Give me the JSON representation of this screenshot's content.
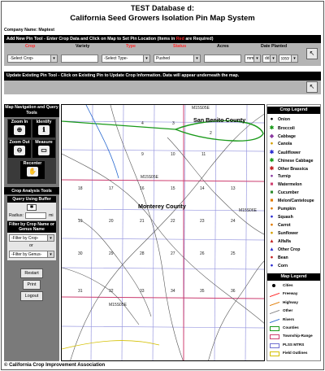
{
  "header": {
    "line1": "TEST Database d:",
    "line2": "California Seed Growers Isolation Pin Map System"
  },
  "company": "Company Name: Maptest",
  "new_pin": {
    "title_part1": "Add New Pin Tool - Enter Crop Data and Click on Map to Set Pin Location (Items in ",
    "title_red": "Red",
    "title_part2": " are Required)",
    "columns": {
      "crop": "Crop",
      "variety": "Variety",
      "type": "Type",
      "status": "Status",
      "acres": "Acres",
      "date_planted": "Date Planted"
    },
    "crop_select": "-Select Crop-",
    "type_select": "-Select Type-",
    "status_select": "Pushed",
    "date_mm": "mm",
    "date_dd": "dd",
    "date_yyyy": "yyyy",
    "go_icon": "pointer-arrow"
  },
  "update_pin": {
    "title": "Update Existing Pin Tool - Click on Existing Pin to Update Crop Information. Data will appear underneath the map.",
    "go_icon": "pointer-arrow"
  },
  "nav": {
    "title": "Map Navigation and Query Tools",
    "zoom_in": "Zoom In",
    "identify": "Identify",
    "zoom_out": "Zoom Out",
    "measure": "Measure",
    "recenter": "Recenter"
  },
  "analysis": {
    "title": "Crop Analysis Tools",
    "buffer_title": "Query Using Buffer",
    "radius_label": "Radius:",
    "radius_unit": "mi",
    "filter_title": "Filter by Crop Name or Genus Name",
    "filter_crop": "-Filter by Crop-",
    "or_label": "or",
    "filter_genus": "-Filter by Genus-"
  },
  "buttons": {
    "restart": "Restart",
    "print": "Print",
    "logout": "Logout"
  },
  "map": {
    "labels": {
      "san_benito": "San Benito County",
      "monterey": "Monterey County",
      "m15s05e_top": "M15S05E",
      "m15s05e_mid": "M15S05E",
      "m15s06e": "M15S06E",
      "m15s05e_bot": "M15S05E"
    },
    "section_numbers": [
      "4",
      "3",
      "2",
      "9",
      "10",
      "11",
      "17",
      "16",
      "15",
      "14",
      "13",
      "18",
      "20",
      "21",
      "22",
      "23",
      "24",
      "19",
      "29",
      "28",
      "27",
      "26",
      "25",
      "30",
      "32",
      "33",
      "34",
      "35",
      "36",
      "31"
    ]
  },
  "crop_legend": {
    "title": "Crop Legend",
    "items": [
      {
        "name": "Onion",
        "symbol": "●",
        "color": "#000000"
      },
      {
        "name": "Broccoli",
        "symbol": "✱",
        "color": "#1a9a1a"
      },
      {
        "name": "Cabbage",
        "symbol": "◆",
        "color": "#8a3aa0"
      },
      {
        "name": "Canola",
        "symbol": "●",
        "color": "#d4a000"
      },
      {
        "name": "Cauliflower",
        "symbol": "✱",
        "color": "#2a2ad0"
      },
      {
        "name": "Chinese Cabbage",
        "symbol": "✱",
        "color": "#1a9a1a"
      },
      {
        "name": "Other Brassica",
        "symbol": "✱",
        "color": "#c02020"
      },
      {
        "name": "Turnip",
        "symbol": "●",
        "color": "#8a3aa0"
      },
      {
        "name": "Watermelon",
        "symbol": "■",
        "color": "#d04070"
      },
      {
        "name": "Cucumber",
        "symbol": "■",
        "color": "#2a8a2a"
      },
      {
        "name": "Melon/Canteloupe",
        "symbol": "■",
        "color": "#e07a00"
      },
      {
        "name": "Pumpkin",
        "symbol": "●",
        "color": "#e07a00"
      },
      {
        "name": "Squash",
        "symbol": "●",
        "color": "#2a2ad0"
      },
      {
        "name": "Carrot",
        "symbol": "●",
        "color": "#e07a00"
      },
      {
        "name": "Sunflower",
        "symbol": "●",
        "color": "#d4a000"
      },
      {
        "name": "Alfalfa",
        "symbol": "▲",
        "color": "#c02020"
      },
      {
        "name": "Other Crop",
        "symbol": "▲",
        "color": "#2a2ad0"
      },
      {
        "name": "Bean",
        "symbol": "●",
        "color": "#c02020"
      },
      {
        "name": "Corn",
        "symbol": "●",
        "color": "#2a2ad0"
      }
    ]
  },
  "map_legend": {
    "title": "Map Legend",
    "items": [
      {
        "name": "Cities",
        "kind": "dot",
        "color": "#000000"
      },
      {
        "name": "Freeway",
        "kind": "line",
        "color": "#ff2020"
      },
      {
        "name": "Highway",
        "kind": "line",
        "color": "#e07a00"
      },
      {
        "name": "Other",
        "kind": "line",
        "color": "#888888"
      },
      {
        "name": "Rivers",
        "kind": "line",
        "color": "#2a6ad0"
      },
      {
        "name": "Counties",
        "kind": "box",
        "color": "#1a9a1a"
      },
      {
        "name": "Township-Range",
        "kind": "box",
        "color": "#d04070"
      },
      {
        "name": "PLSS MTRS",
        "kind": "box",
        "color": "#7070d0"
      },
      {
        "name": "Field Outlines",
        "kind": "box",
        "color": "#d4c000"
      }
    ]
  },
  "footer": "© California Crop Improvement Association"
}
